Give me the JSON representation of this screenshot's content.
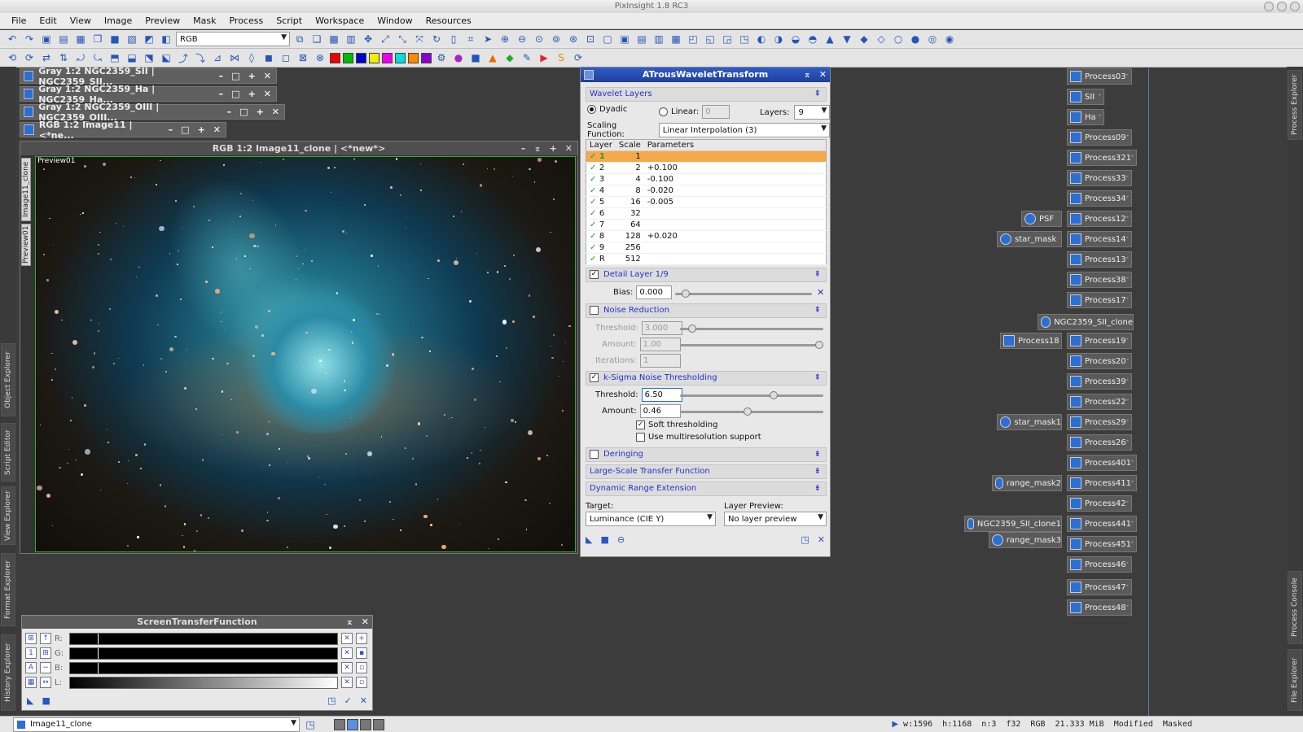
{
  "window_title": "PixInsight 1.8 RC3",
  "menu": [
    "File",
    "Edit",
    "View",
    "Image",
    "Preview",
    "Mask",
    "Process",
    "Script",
    "Workspace",
    "Window",
    "Resources"
  ],
  "toolbar": {
    "rgb_combo": "RGB"
  },
  "colors": {
    "accent": "#2233cc",
    "selected_row": "#f5a94a",
    "title_blue": "#1f3f9a"
  },
  "image_windows": [
    {
      "title": "Gray 1:2 NGC2359_SII | NGC2359_SII..."
    },
    {
      "title": "Gray 1:2 NGC2359_Ha | NGC2359_Ha..."
    },
    {
      "title": "Gray 1:2 NGC2359_OIII | NGC2359_OIII..."
    },
    {
      "title": "RGB 1:2 Image11 | <*ne..."
    }
  ],
  "main_image": {
    "title": "RGB 1:2 Image11_clone | <*new*>",
    "preview_label": "Preview01",
    "tabs": [
      "Image11_clone",
      "Preview01"
    ]
  },
  "left_tabs": [
    "Object Explorer",
    "Script Editor",
    "View Explorer",
    "Format Explorer",
    "History Explorer"
  ],
  "right_tabs": [
    "Process Explorer",
    "Process Console",
    "File Explorer"
  ],
  "dialog": {
    "title": "ATrousWaveletTransform",
    "sections": {
      "wavelet_layers": "Wavelet Layers",
      "detail_layer": "Detail Layer 1/9",
      "noise_reduction": "Noise Reduction",
      "ksigma": "k-Sigma Noise Thresholding",
      "deringing": "Deringing",
      "large_scale": "Large-Scale Transfer Function",
      "dynamic_range": "Dynamic Range Extension"
    },
    "dyadic_label": "Dyadic",
    "linear_label": "Linear:",
    "linear_value": "0",
    "layers_label": "Layers:",
    "layers_value": "9",
    "scaling_label": "Scaling Function:",
    "scaling_value": "Linear Interpolation (3)",
    "table_headers": [
      "Layer",
      "Scale",
      "Parameters"
    ],
    "table_rows": [
      {
        "layer": "1",
        "scale": "1",
        "params": ""
      },
      {
        "layer": "2",
        "scale": "2",
        "params": "+0.100"
      },
      {
        "layer": "3",
        "scale": "4",
        "params": "-0.100"
      },
      {
        "layer": "4",
        "scale": "8",
        "params": "-0.020"
      },
      {
        "layer": "5",
        "scale": "16",
        "params": "-0.005"
      },
      {
        "layer": "6",
        "scale": "32",
        "params": ""
      },
      {
        "layer": "7",
        "scale": "64",
        "params": ""
      },
      {
        "layer": "8",
        "scale": "128",
        "params": "+0.020"
      },
      {
        "layer": "9",
        "scale": "256",
        "params": ""
      },
      {
        "layer": "R",
        "scale": "512",
        "params": ""
      }
    ],
    "bias_label": "Bias:",
    "bias_value": "0.000",
    "nr_threshold_label": "Threshold:",
    "nr_threshold_value": "3.000",
    "nr_amount_label": "Amount:",
    "nr_amount_value": "1.00",
    "nr_iterations_label": "Iterations:",
    "nr_iterations_value": "1",
    "ks_threshold_label": "Threshold:",
    "ks_threshold_value": "6.50",
    "ks_amount_label": "Amount:",
    "ks_amount_value": "0.46",
    "soft_label": "Soft thresholding",
    "multires_label": "Use multiresolution support",
    "target_label": "Target:",
    "target_value": "Luminance (CIE Y)",
    "layer_preview_label": "Layer Preview:",
    "layer_preview_value": "No layer preview"
  },
  "process_icons": [
    "Process03",
    "SII",
    "Ha",
    "Process09",
    "Process321",
    "Process33",
    "Process34",
    "Process12",
    "Process14",
    "Process13",
    "Process38",
    "Process17",
    "Process19",
    "Process20",
    "Process39",
    "Process22",
    "Process29",
    "Process26",
    "Process401",
    "Process411",
    "Process42",
    "Process441",
    "Process451",
    "Process46",
    "Process47",
    "Process48"
  ],
  "left_icons": [
    "PSF",
    "star_mask",
    "NGC2359_SII_clone",
    "Process18",
    "star_mask1",
    "range_mask2",
    "NGC2359_SII_clone1",
    "range_mask3"
  ],
  "stf": {
    "title": "ScreenTransferFunction",
    "channels": [
      "R:",
      "G:",
      "B:",
      "L:"
    ]
  },
  "status": {
    "view": "Image11_clone",
    "width": "w:1596",
    "height": "h:1168",
    "channels": "n:3",
    "depth": "f32",
    "colorspace": "RGB",
    "size": "21.333 MiB",
    "modified": "Modified",
    "masked": "Masked"
  }
}
